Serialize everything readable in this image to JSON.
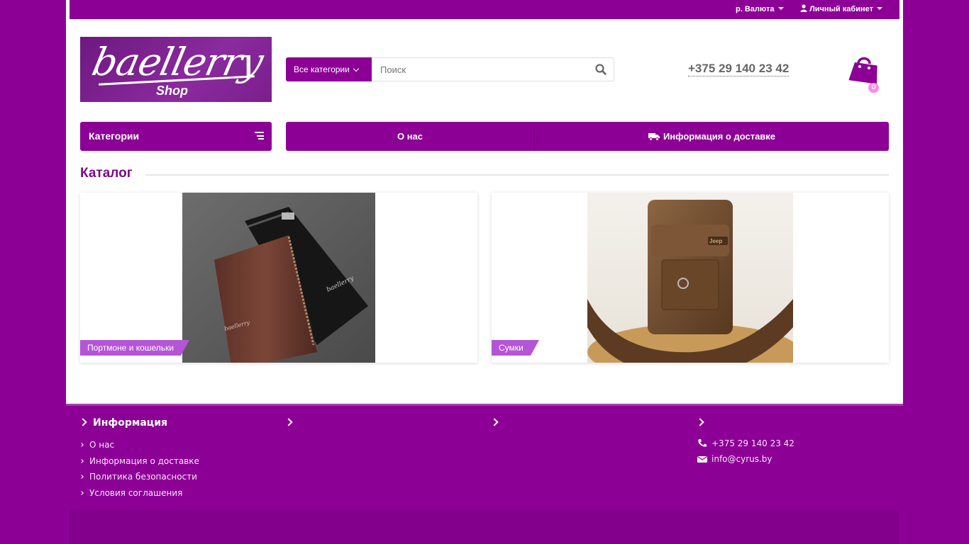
{
  "topbar": {
    "currency_label": "р.  Валюта",
    "account_label": "Личный кабинет"
  },
  "logo": {
    "brand": "baellerry",
    "sub": "Shop"
  },
  "search": {
    "category_label": "Все категории",
    "placeholder": "Поиск"
  },
  "header": {
    "phone": "+375 29 140 23 42",
    "cart_count": "0"
  },
  "nav": {
    "categories_label": "Категории",
    "items": [
      {
        "label": "О нас"
      },
      {
        "label": "Информация о доставке"
      }
    ]
  },
  "catalog": {
    "title": "Каталог",
    "cards": [
      {
        "label": "Портмоне и кошельки"
      },
      {
        "label": "Сумки"
      }
    ]
  },
  "footer": {
    "info_title": "Информация",
    "links": [
      "О нас",
      "Информация о доставке",
      "Политика безопасности",
      "Условия соглашения"
    ],
    "contacts": {
      "phone": "+375 29 140 23 42",
      "email": "info@cyrus.by"
    }
  },
  "colors": {
    "brand": "#8d0096",
    "label": "#b455d6",
    "cart_badge": "#f58ee8"
  }
}
